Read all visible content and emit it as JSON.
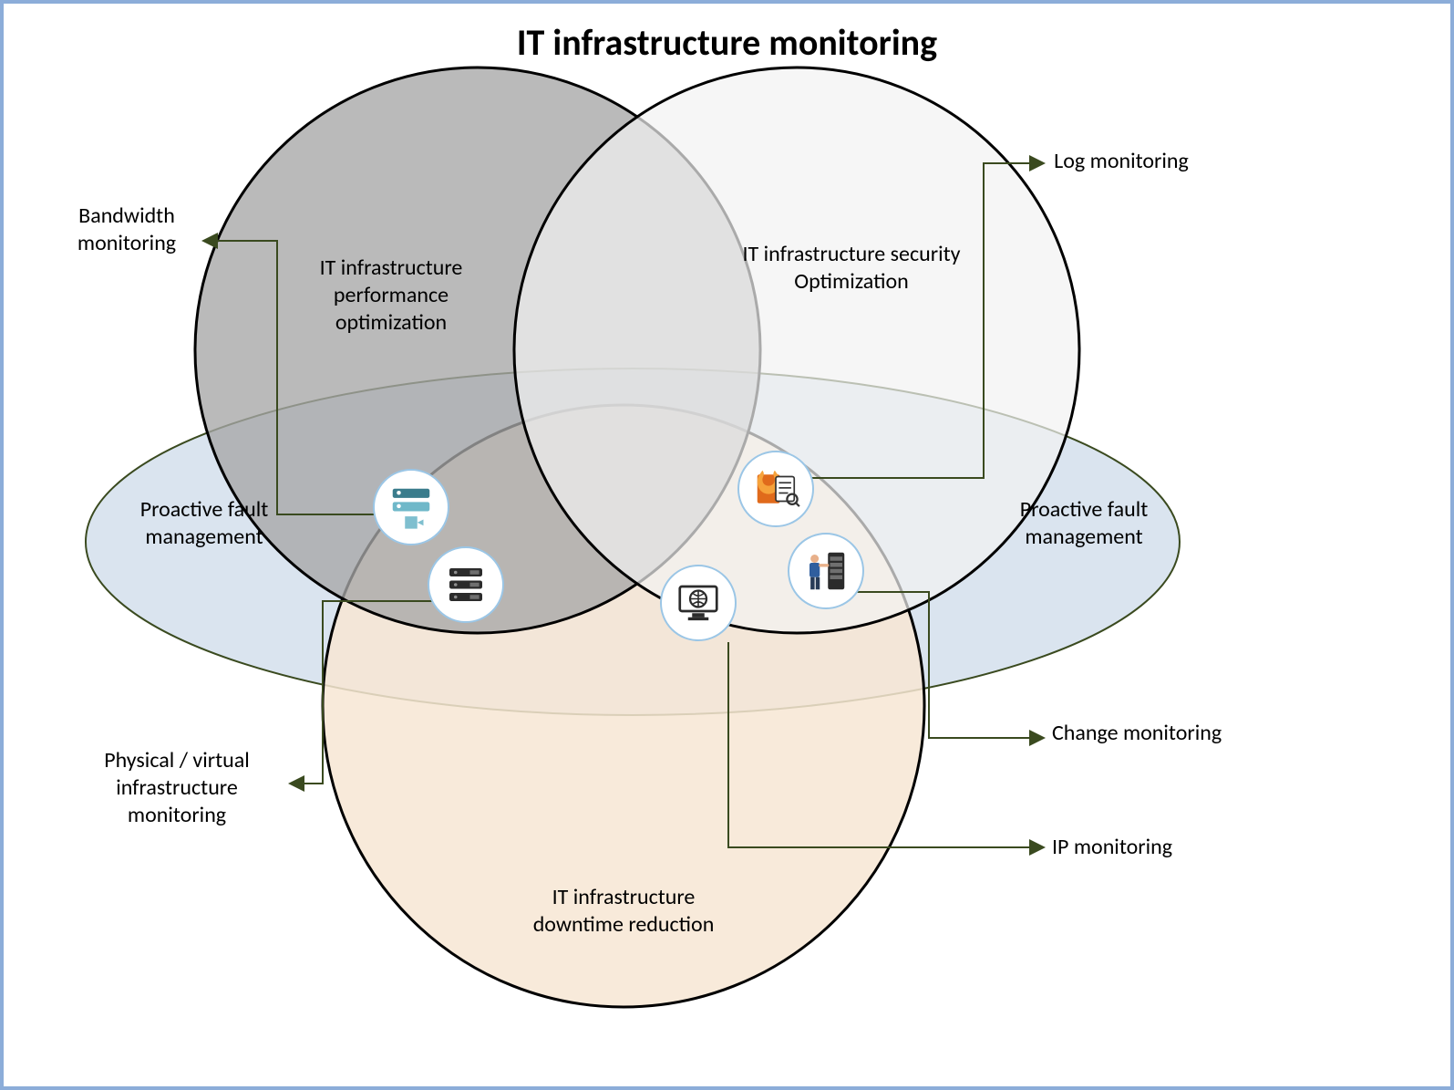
{
  "title": "IT infrastructure monitoring",
  "ellipse": {
    "label_left": "Proactive fault management",
    "label_right": "Proactive fault management"
  },
  "circles": {
    "perf": {
      "label": "IT infrastructure performance optimization"
    },
    "sec": {
      "label": "IT infrastructure security Optimization"
    },
    "down": {
      "label": "IT infrastructure downtime reduction"
    }
  },
  "callouts": {
    "bandwidth": "Bandwidth monitoring",
    "log": "Log monitoring",
    "physical": "Physical / virtual infrastructure monitoring",
    "change": "Change monitoring",
    "ip": "IP monitoring"
  },
  "icons": {
    "bandwidth": "server-network-icon",
    "physical": "server-stack-icon",
    "log": "firewall-log-icon",
    "ip": "globe-monitor-icon",
    "change": "admin-rack-icon"
  }
}
